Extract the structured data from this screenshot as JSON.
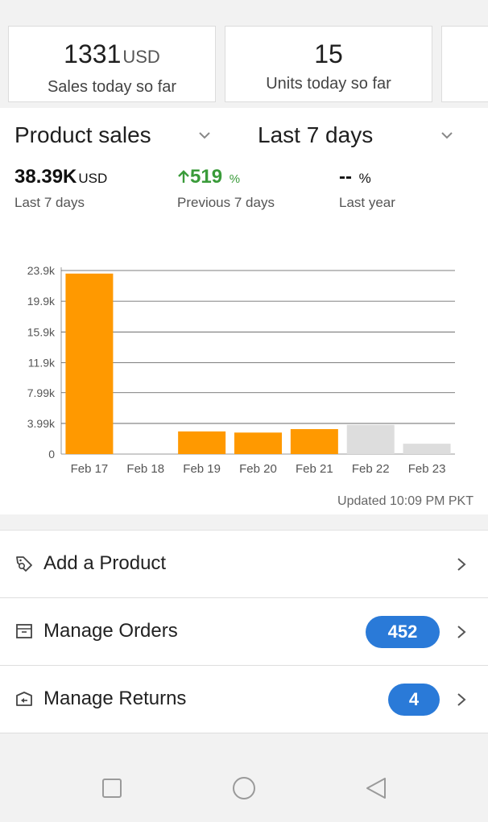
{
  "stats": [
    {
      "value": "1331",
      "unit": "USD",
      "label": "Sales today so far"
    },
    {
      "value": "15",
      "unit": "",
      "label": "Units today so far"
    }
  ],
  "sales": {
    "metric_selector": "Product sales",
    "period_selector": "Last 7 days",
    "current": {
      "value": "38.39K",
      "unit": "USD",
      "label": "Last 7 days"
    },
    "previous": {
      "value": "519",
      "unit": "%",
      "label": "Previous 7 days"
    },
    "last_year": {
      "value": "--",
      "unit": "%",
      "label": "Last year"
    },
    "updated": "Updated 10:09 PM PKT"
  },
  "chart_data": {
    "type": "bar",
    "categories": [
      "Feb 17",
      "Feb 18",
      "Feb 19",
      "Feb 20",
      "Feb 21",
      "Feb 22",
      "Feb 23"
    ],
    "values": [
      23500,
      0,
      2950,
      2800,
      3250,
      3800,
      1350
    ],
    "bar_colors": [
      "#ff9900",
      "#ff9900",
      "#ff9900",
      "#ff9900",
      "#ff9900",
      "#dddddd",
      "#dddddd"
    ],
    "yticks": [
      "0",
      "3.99k",
      "7.99k",
      "11.9k",
      "15.9k",
      "19.9k",
      "23.9k"
    ],
    "ytick_values": [
      0,
      3990,
      7990,
      11900,
      15900,
      19900,
      23900
    ],
    "ylim": [
      0,
      23900
    ],
    "grid": true
  },
  "menu": [
    {
      "label": "Add a Product",
      "icon": "tag-icon",
      "badge": ""
    },
    {
      "label": "Manage Orders",
      "icon": "box-icon",
      "badge": "452"
    },
    {
      "label": "Manage Returns",
      "icon": "return-box-icon",
      "badge": "4"
    }
  ],
  "colors": {
    "accent": "#ff9900",
    "badge": "#2a7ad8",
    "positive": "#3a9b3a"
  }
}
